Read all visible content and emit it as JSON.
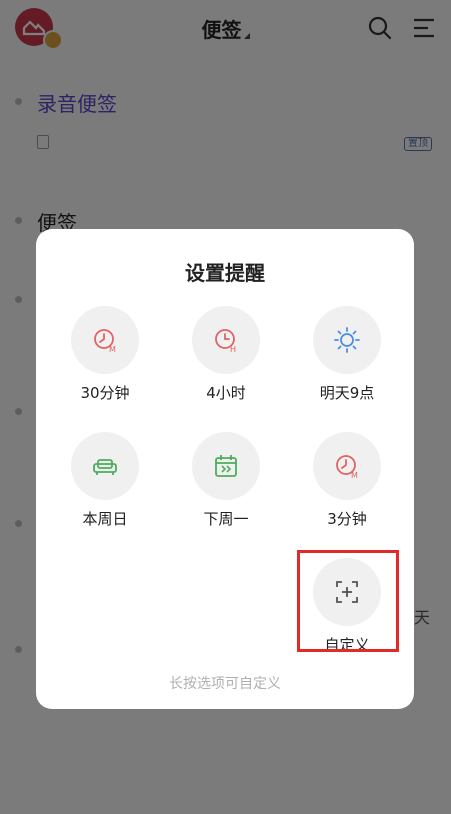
{
  "app": {
    "title": "便签",
    "sections": [
      {
        "title": "录音便签",
        "tag": "置顶"
      },
      {
        "title": "便签"
      }
    ],
    "side_char": "天"
  },
  "dialog": {
    "title": "设置提醒",
    "options": [
      {
        "label": "30分钟",
        "icon": "clock-m-icon",
        "color": "#e06464"
      },
      {
        "label": "4小时",
        "icon": "clock-h-icon",
        "color": "#e06464"
      },
      {
        "label": "明天9点",
        "icon": "sun-icon",
        "color": "#4a90e2"
      },
      {
        "label": "本周日",
        "icon": "sofa-icon",
        "color": "#4cae5a"
      },
      {
        "label": "下周一",
        "icon": "calendar-next-icon",
        "color": "#4cae5a"
      },
      {
        "label": "3分钟",
        "icon": "clock-m-icon",
        "color": "#e06464"
      },
      {
        "label": "自定义",
        "icon": "custom-plus-icon",
        "color": "#555555"
      }
    ],
    "hint": "长按选项可自定义"
  },
  "colors": {
    "highlight": "#e12a2a",
    "accent_purple": "#5a46c8"
  }
}
